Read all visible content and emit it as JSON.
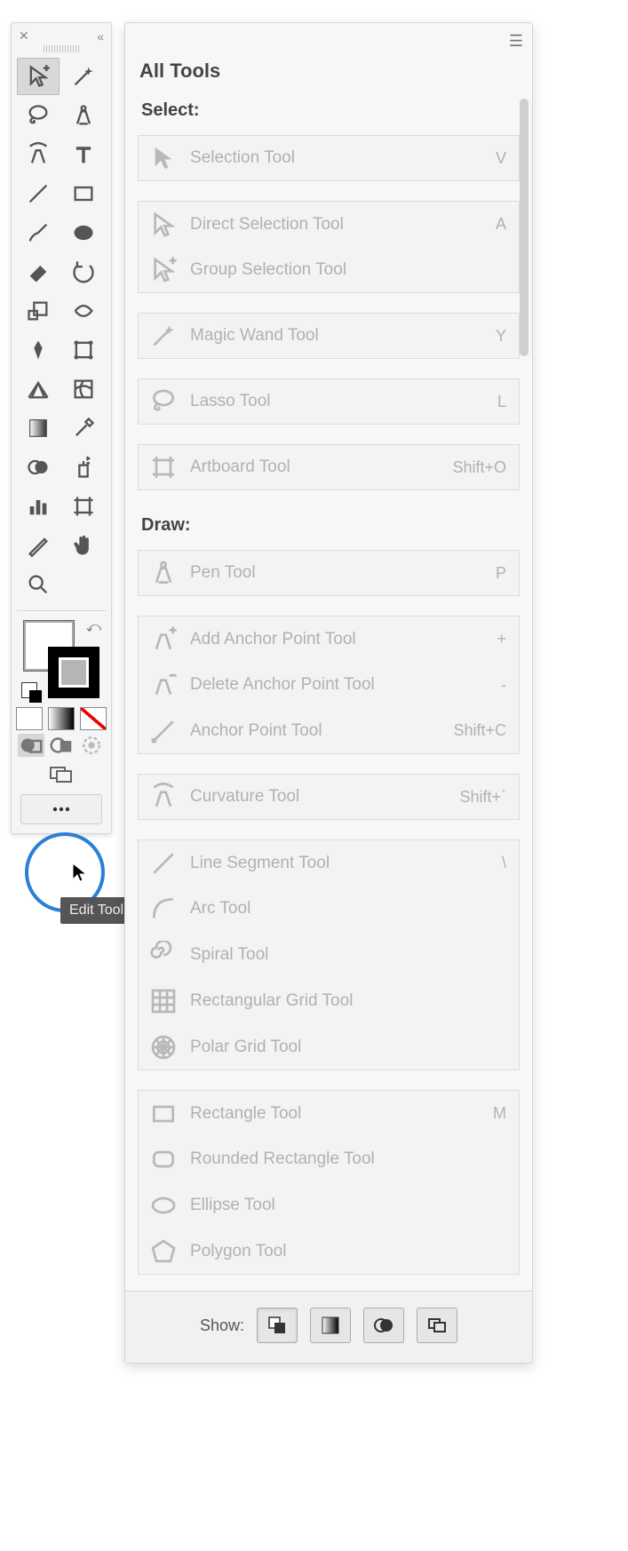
{
  "tooltip": "Edit Toolbar...",
  "toolbar": {
    "tools": [
      {
        "name": "group-selection",
        "icon": "selection-plus",
        "selected": true
      },
      {
        "name": "magic-wand",
        "icon": "wand"
      },
      {
        "name": "lasso",
        "icon": "lasso"
      },
      {
        "name": "pen",
        "icon": "pen"
      },
      {
        "name": "curvature",
        "icon": "curvature"
      },
      {
        "name": "type",
        "icon": "type"
      },
      {
        "name": "line",
        "icon": "line"
      },
      {
        "name": "rectangle",
        "icon": "rect"
      },
      {
        "name": "paintbrush",
        "icon": "brush"
      },
      {
        "name": "shaper",
        "icon": "blob"
      },
      {
        "name": "eraser",
        "icon": "eraser"
      },
      {
        "name": "rotate",
        "icon": "rotate"
      },
      {
        "name": "scale",
        "icon": "scale"
      },
      {
        "name": "width",
        "icon": "width"
      },
      {
        "name": "puppet",
        "icon": "pin"
      },
      {
        "name": "free-transform",
        "icon": "free-transform"
      },
      {
        "name": "perspective",
        "icon": "perspective-grid"
      },
      {
        "name": "mesh",
        "icon": "mesh"
      },
      {
        "name": "gradient",
        "icon": "gradient"
      },
      {
        "name": "eyedropper",
        "icon": "eyedropper"
      },
      {
        "name": "blend",
        "icon": "blend"
      },
      {
        "name": "symbol-sprayer",
        "icon": "spray"
      },
      {
        "name": "column-graph",
        "icon": "bar-chart"
      },
      {
        "name": "artboard",
        "icon": "artboard"
      },
      {
        "name": "slice",
        "icon": "slice"
      },
      {
        "name": "hand",
        "icon": "hand"
      },
      {
        "name": "zoom",
        "icon": "zoom"
      }
    ]
  },
  "drawmodes": [
    {
      "name": "draw-normal",
      "icon": "draw-normal",
      "selected": true
    },
    {
      "name": "draw-behind",
      "icon": "draw-behind"
    },
    {
      "name": "draw-inside",
      "icon": "draw-inside"
    }
  ],
  "panel": {
    "title": "All Tools",
    "sections": [
      {
        "label": "Select:",
        "groups": [
          [
            {
              "label": "Selection Tool",
              "shortcut": "V",
              "icon": "selection"
            }
          ],
          [
            {
              "label": "Direct Selection Tool",
              "shortcut": "A",
              "icon": "direct-selection"
            },
            {
              "label": "Group Selection Tool",
              "shortcut": "",
              "icon": "selection-plus"
            }
          ],
          [
            {
              "label": "Magic Wand Tool",
              "shortcut": "Y",
              "icon": "wand"
            }
          ],
          [
            {
              "label": "Lasso Tool",
              "shortcut": "L",
              "icon": "lasso"
            }
          ],
          [
            {
              "label": "Artboard Tool",
              "shortcut": "Shift+O",
              "icon": "artboard"
            }
          ]
        ]
      },
      {
        "label": "Draw:",
        "groups": [
          [
            {
              "label": "Pen Tool",
              "shortcut": "P",
              "icon": "pen"
            }
          ],
          [
            {
              "label": "Add Anchor Point Tool",
              "shortcut": "+",
              "icon": "pen-plus"
            },
            {
              "label": "Delete Anchor Point Tool",
              "shortcut": "-",
              "icon": "pen-minus"
            },
            {
              "label": "Anchor Point Tool",
              "shortcut": "Shift+C",
              "icon": "anchor"
            }
          ],
          [
            {
              "label": "Curvature Tool",
              "shortcut": "Shift+`",
              "icon": "curvature"
            }
          ],
          [
            {
              "label": "Line Segment Tool",
              "shortcut": "\\",
              "icon": "line"
            },
            {
              "label": "Arc Tool",
              "shortcut": "",
              "icon": "arc"
            },
            {
              "label": "Spiral Tool",
              "shortcut": "",
              "icon": "spiral"
            },
            {
              "label": "Rectangular Grid Tool",
              "shortcut": "",
              "icon": "rect-grid"
            },
            {
              "label": "Polar Grid Tool",
              "shortcut": "",
              "icon": "polar-grid"
            }
          ],
          [
            {
              "label": "Rectangle Tool",
              "shortcut": "M",
              "icon": "rect"
            },
            {
              "label": "Rounded Rectangle Tool",
              "shortcut": "",
              "icon": "round-rect"
            },
            {
              "label": "Ellipse Tool",
              "shortcut": "",
              "icon": "ellipse"
            },
            {
              "label": "Polygon Tool",
              "shortcut": "",
              "icon": "polygon"
            }
          ]
        ]
      }
    ],
    "footer": {
      "label": "Show:",
      "buttons": [
        {
          "name": "show-fill-stroke",
          "icon": "fill-stroke"
        },
        {
          "name": "show-gradient",
          "icon": "gradient"
        },
        {
          "name": "show-drawmodes",
          "icon": "drawmodes"
        },
        {
          "name": "show-screenmode",
          "icon": "screenmode"
        }
      ]
    }
  }
}
